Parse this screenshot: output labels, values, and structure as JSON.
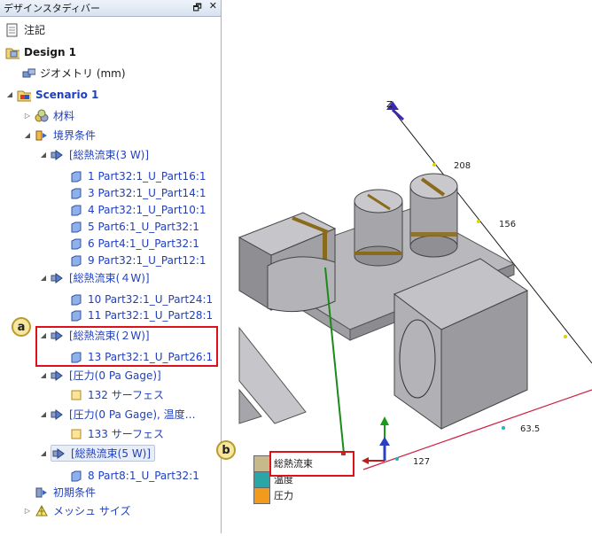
{
  "panel": {
    "title": "デザインスタディバー",
    "pin_icon": "pin-icon",
    "close_icon": "close-icon",
    "tree": {
      "notes": "注記",
      "design": "Design 1",
      "geometry": "ジオメトリ (mm)",
      "scenario": "Scenario 1",
      "materials": "材料",
      "boundary": "境界条件",
      "heatflux3": "[総熱流束(3 W)]",
      "heatflux3_items": [
        "1 Part32:1_U_Part16:1",
        "3 Part32:1_U_Part14:1",
        "4 Part32:1_U_Part10:1",
        "5 Part6:1_U_Part32:1",
        "6 Part4:1_U_Part32:1",
        "9 Part32:1_U_Part12:1"
      ],
      "heatflux4": "[総熱流束(４W)]",
      "heatflux4_items": [
        "10 Part32:1_U_Part24:1",
        "11 Part32:1_U_Part28:1"
      ],
      "heatflux2": "[総熱流束(２W)]",
      "heatflux2_items": [
        "13 Part32:1_U_Part26:1"
      ],
      "pressure": "[圧力(0 Pa Gage)]",
      "pressure_surface": "132 サーフェス",
      "pressure_temp": "[圧力(0 Pa Gage), 温度…",
      "pressure_temp_surface": "133 サーフェス",
      "heatflux5": "[総熱流束(5 W)]",
      "heatflux5_items": [
        "8 Part8:1_U_Part32:1"
      ],
      "initial": "初期条件",
      "mesh": "メッシュ サイズ"
    }
  },
  "callouts": {
    "a": "a",
    "b": "b"
  },
  "view": {
    "axis_z": "Z",
    "dims": [
      "208",
      "156",
      "63.5",
      "127"
    ],
    "legend": [
      {
        "label": "総熱流束",
        "color": "#c8b98a"
      },
      {
        "label": "温度",
        "color": "#2aa6a6"
      },
      {
        "label": "圧力",
        "color": "#f29a1c"
      }
    ]
  }
}
